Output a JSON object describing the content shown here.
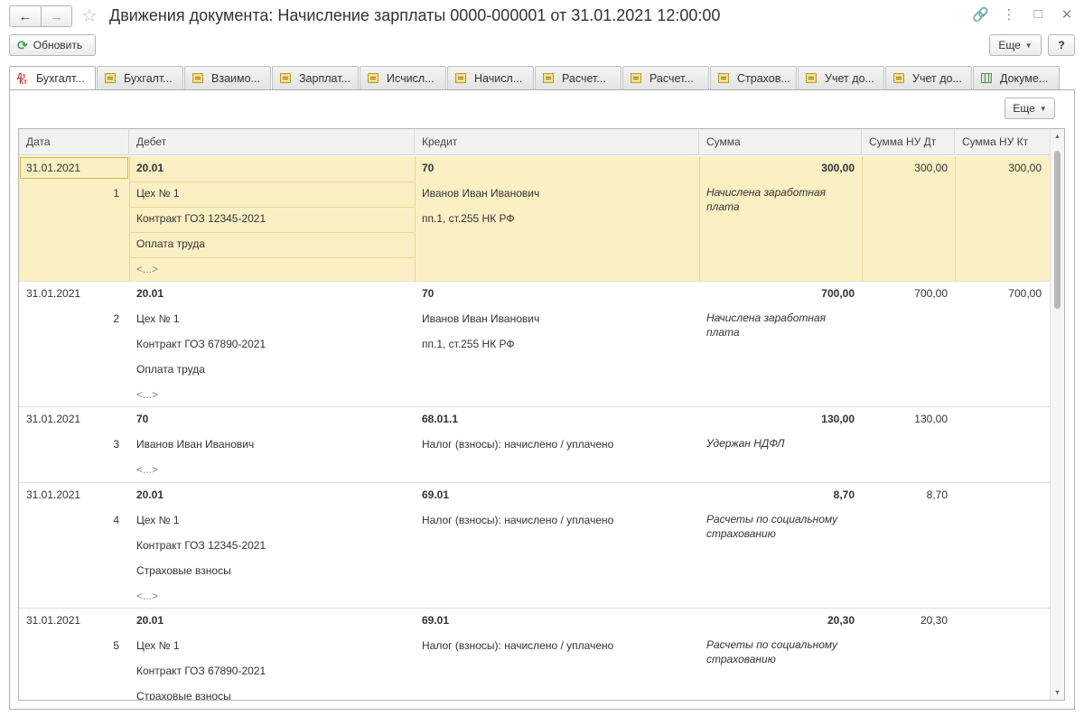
{
  "window": {
    "title": "Движения документа: Начисление зарплаты 0000-000001 от 31.01.2021 12:00:00"
  },
  "toolbar": {
    "refresh_label": "Обновить",
    "more_label": "Еще",
    "help_label": "?"
  },
  "tabs": [
    {
      "label": "Бухгалт...",
      "icon": "dt-kt-icon",
      "active": true
    },
    {
      "label": "Бухгалт...",
      "icon": "register-icon"
    },
    {
      "label": "Взаимо...",
      "icon": "register-icon"
    },
    {
      "label": "Зарплат...",
      "icon": "register-icon"
    },
    {
      "label": "Исчисл...",
      "icon": "register-icon"
    },
    {
      "label": "Начисл...",
      "icon": "register-icon"
    },
    {
      "label": "Расчет...",
      "icon": "register-icon"
    },
    {
      "label": "Расчет...",
      "icon": "register-icon"
    },
    {
      "label": "Страхов...",
      "icon": "register-icon"
    },
    {
      "label": "Учет до...",
      "icon": "register-icon"
    },
    {
      "label": "Учет до...",
      "icon": "register-icon"
    },
    {
      "label": "Докуме...",
      "icon": "table-icon"
    }
  ],
  "panel": {
    "more_label": "Еще"
  },
  "grid": {
    "columns": [
      "Дата",
      "Дебет",
      "Кредит",
      "Сумма",
      "Сумма НУ Дт",
      "Сумма НУ Кт"
    ],
    "rows": [
      {
        "date": "31.01.2021",
        "num": "1",
        "debit": [
          "20.01",
          "Цех № 1",
          "Контракт ГОЗ 12345-2021",
          "Оплата труда",
          "<...>"
        ],
        "credit": [
          "70",
          "Иванов Иван Иванович",
          "пп.1, ст.255 НК РФ"
        ],
        "sum": "300,00",
        "content": "Начислена заработная плата",
        "nu_dt": "300,00",
        "nu_kt": "300,00"
      },
      {
        "date": "31.01.2021",
        "num": "2",
        "debit": [
          "20.01",
          "Цех № 1",
          "Контракт ГОЗ 67890-2021",
          "Оплата труда",
          "<...>"
        ],
        "credit": [
          "70",
          "Иванов Иван Иванович",
          "пп.1, ст.255 НК РФ"
        ],
        "sum": "700,00",
        "content": "Начислена заработная плата",
        "nu_dt": "700,00",
        "nu_kt": "700,00"
      },
      {
        "date": "31.01.2021",
        "num": "3",
        "debit": [
          "70",
          "Иванов Иван Иванович",
          "<...>"
        ],
        "credit": [
          "68.01.1",
          "Налог (взносы): начислено / уплачено"
        ],
        "sum": "130,00",
        "content": "Удержан НДФЛ",
        "nu_dt": "130,00",
        "nu_kt": ""
      },
      {
        "date": "31.01.2021",
        "num": "4",
        "debit": [
          "20.01",
          "Цех № 1",
          "Контракт ГОЗ 12345-2021",
          "Страховые взносы",
          "<...>"
        ],
        "credit": [
          "69.01",
          "Налог (взносы): начислено / уплачено"
        ],
        "sum": "8,70",
        "content": "Расчеты по социальному страхованию",
        "nu_dt": "8,70",
        "nu_kt": ""
      },
      {
        "date": "31.01.2021",
        "num": "5",
        "debit": [
          "20.01",
          "Цех № 1",
          "Контракт ГОЗ 67890-2021",
          "Страховые взносы"
        ],
        "credit": [
          "69.01",
          "Налог (взносы): начислено / уплачено"
        ],
        "sum": "20,30",
        "content": "Расчеты по социальному страхованию",
        "nu_dt": "20,30",
        "nu_kt": ""
      }
    ]
  }
}
